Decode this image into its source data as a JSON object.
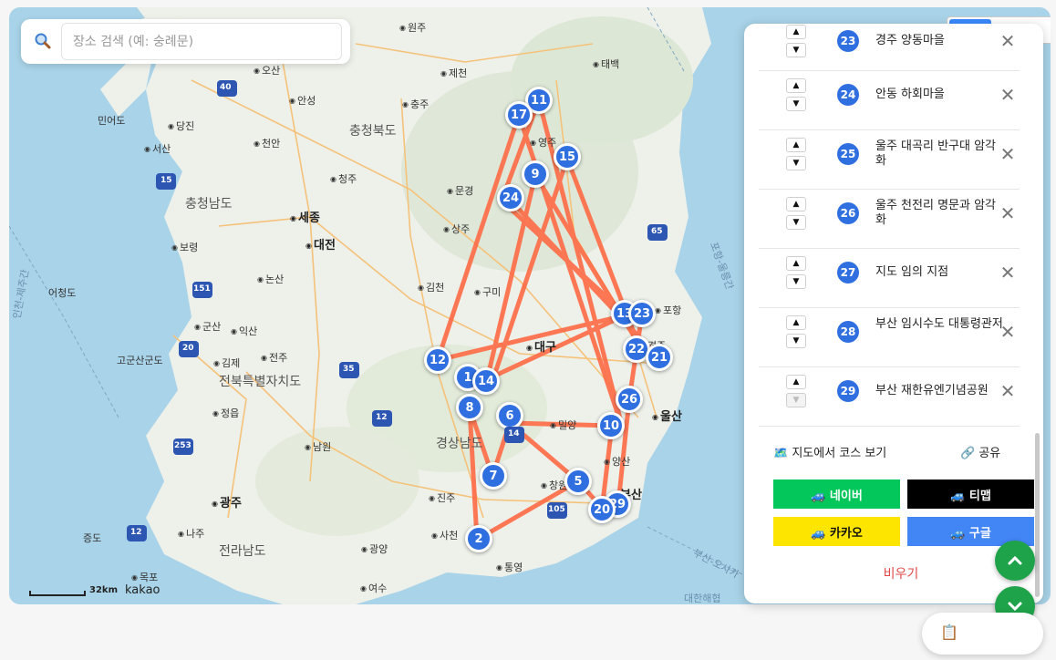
{
  "search": {
    "placeholder": "장소 검색 (예: 숭례문)"
  },
  "map": {
    "scale_label": "32km",
    "provider": "kakao",
    "regions": [
      "충청북도",
      "충청남도",
      "전북특별자치도",
      "경상남도",
      "전라남도"
    ],
    "cities": [
      "세종",
      "대전",
      "대구",
      "울산",
      "부산",
      "광주"
    ],
    "towns": [
      "원주",
      "제천",
      "태백",
      "충주",
      "오산",
      "안성",
      "당진",
      "천안",
      "청주",
      "서산",
      "문경",
      "영주",
      "상주",
      "보령",
      "논산",
      "김천",
      "구미",
      "군산",
      "익산",
      "김제",
      "전주",
      "포항",
      "경주",
      "정읍",
      "밀양",
      "남원",
      "양산",
      "진주",
      "창원",
      "사천",
      "나주",
      "광양",
      "목포",
      "통영",
      "여수"
    ],
    "other_labels": [
      "민어도",
      "어청도",
      "고군산군도",
      "증도",
      "인천-제주간",
      "포항-울릉간",
      "부산-오사카",
      "대한해협"
    ],
    "highways": [
      "40",
      "15",
      "151",
      "20",
      "35",
      "12",
      "253",
      "12",
      "65",
      "105",
      "14"
    ]
  },
  "markers": [
    "11",
    "17",
    "15",
    "9",
    "24",
    "12",
    "1",
    "14",
    "8",
    "6",
    "7",
    "2",
    "5",
    "29",
    "20",
    "10",
    "26",
    "22",
    "21",
    "13",
    "23"
  ],
  "panel": {
    "items": [
      {
        "num": "23",
        "name": "경주 양동마을"
      },
      {
        "num": "24",
        "name": "안동 하회마을"
      },
      {
        "num": "25",
        "name": "울주 대곡리 반구대 암각화"
      },
      {
        "num": "26",
        "name": "울주 천전리 명문과 암각화"
      },
      {
        "num": "27",
        "name": "지도 임의 지점"
      },
      {
        "num": "28",
        "name": "부산 임시수도 대통령관저"
      },
      {
        "num": "29",
        "name": "부산 재한유엔기념공원"
      }
    ],
    "up_glyph": "▲",
    "down_glyph": "▼",
    "delete_glyph": "✕",
    "view_course": "🗺️ 지도에서 코스 보기",
    "share": "🔗 공유",
    "nav": {
      "naver": "🚙 네이버",
      "tmap": "🚙 티맵",
      "kakao": "🚙 카카오",
      "google": "🚙 구글"
    },
    "clear": "비우기"
  },
  "colors": {
    "route": "#ff6b45",
    "marker": "#2f6fe0",
    "fab": "#1fa34a"
  }
}
